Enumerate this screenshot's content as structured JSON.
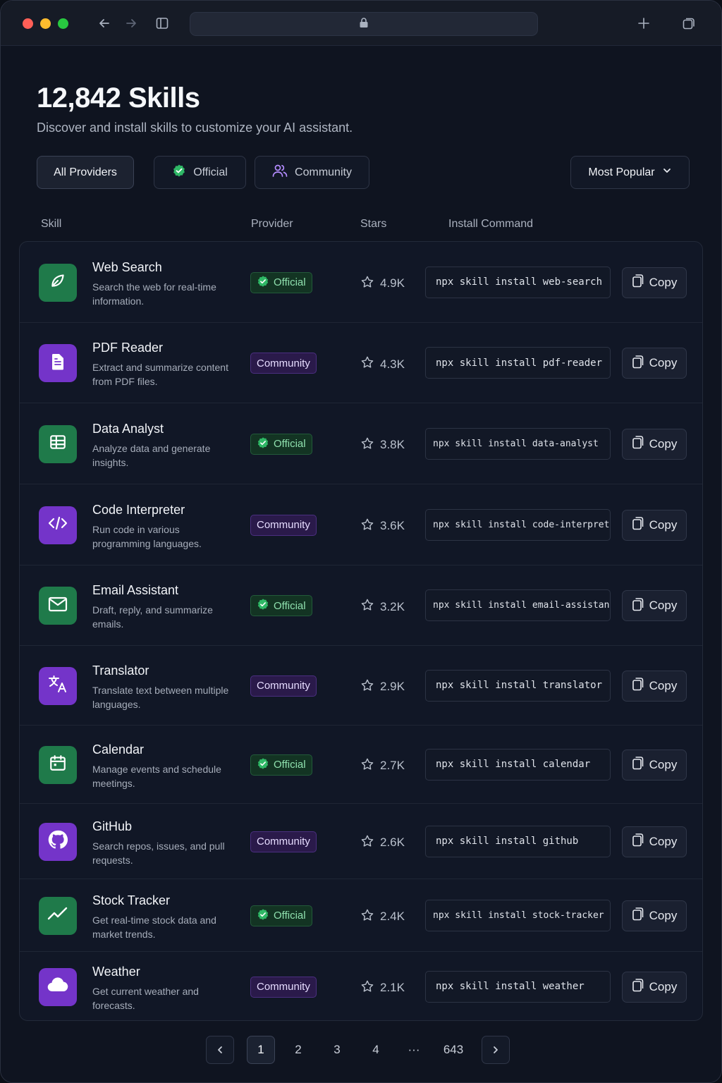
{
  "page": {
    "title": "12,842 Skills",
    "subtitle": "Discover and install skills to customize your AI assistant."
  },
  "filters": {
    "all": "All Providers",
    "official": "Official",
    "community": "Community",
    "sort": "Most Popular"
  },
  "columns": {
    "skill": "Skill",
    "provider": "Provider",
    "stars": "Stars",
    "install": "Install Command"
  },
  "copy_label": "Copy",
  "colors": {
    "official_accent": "#1f7a4a",
    "community_accent": "#7434c9"
  },
  "skills": [
    {
      "name": "Web Search",
      "desc": "Search the web for real-time information.",
      "provider": "Official",
      "stars": "4.9K",
      "command": "npx skill install web-search",
      "icon": "leaf-icon"
    },
    {
      "name": "PDF Reader",
      "desc": "Extract and summarize content from PDF files.",
      "provider": "Community",
      "stars": "4.3K",
      "command": "npx skill install pdf-reader",
      "icon": "document-icon"
    },
    {
      "name": "Data Analyst",
      "desc": "Analyze data and generate insights.",
      "provider": "Official",
      "stars": "3.8K",
      "command": "npx skill install data-analyst",
      "icon": "table-icon"
    },
    {
      "name": "Code Interpreter",
      "desc": "Run code in various programming languages.",
      "provider": "Community",
      "stars": "3.6K",
      "command": "npx skill install code-interpreter",
      "icon": "code-icon"
    },
    {
      "name": "Email Assistant",
      "desc": "Draft, reply, and summarize emails.",
      "provider": "Official",
      "stars": "3.2K",
      "command": "npx skill install email-assistant",
      "icon": "mail-icon"
    },
    {
      "name": "Translator",
      "desc": "Translate text between multiple languages.",
      "provider": "Community",
      "stars": "2.9K",
      "command": "npx skill install translator",
      "icon": "translate-icon"
    },
    {
      "name": "Calendar",
      "desc": "Manage events and schedule meetings.",
      "provider": "Official",
      "stars": "2.7K",
      "command": "npx skill install calendar",
      "icon": "calendar-icon"
    },
    {
      "name": "GitHub",
      "desc": "Search repos, issues, and pull requests.",
      "provider": "Community",
      "stars": "2.6K",
      "command": "npx skill install github",
      "icon": "github-icon"
    },
    {
      "name": "Stock Tracker",
      "desc": "Get real-time stock data and market trends.",
      "provider": "Official",
      "stars": "2.4K",
      "command": "npx skill install stock-tracker",
      "icon": "trend-icon"
    },
    {
      "name": "Weather",
      "desc": "Get current weather and forecasts.",
      "provider": "Community",
      "stars": "2.1K",
      "command": "npx skill install weather",
      "icon": "cloud-icon"
    }
  ],
  "pagination": {
    "pages": [
      "1",
      "2",
      "3",
      "4"
    ],
    "ellipsis": "···",
    "last": "643",
    "current": "1"
  }
}
